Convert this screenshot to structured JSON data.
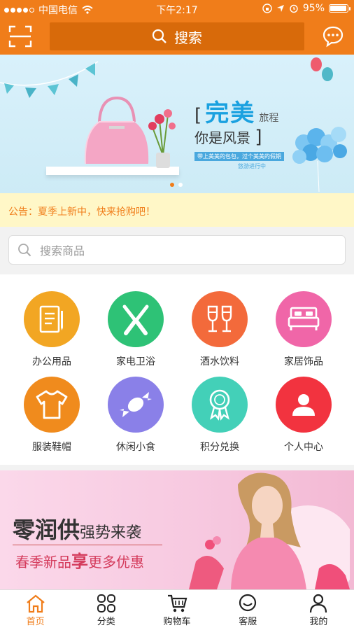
{
  "status_bar": {
    "carrier": "中国电信",
    "time": "下午2:17",
    "battery": "95%",
    "battery_level": 0.95
  },
  "header": {
    "search_label": "搜索"
  },
  "banner": {
    "headline": "完美",
    "suffix": "旅程",
    "line2": "你是风景",
    "tagline": "带上美美的包包，过个美美的假期",
    "tagline2": "悠游进行中",
    "slides": 2,
    "active_slide": 0
  },
  "notice": {
    "text": "公告：夏季上新中，快来抢购吧！"
  },
  "product_search": {
    "placeholder": "搜索商品"
  },
  "categories": [
    {
      "label": "办公用品",
      "color": "#f2a623",
      "icon": "notepad-icon"
    },
    {
      "label": "家电卫浴",
      "color": "#2ec276",
      "icon": "pliers-icon"
    },
    {
      "label": "酒水饮料",
      "color": "#f36a3b",
      "icon": "wine-glasses-icon"
    },
    {
      "label": "家居饰品",
      "color": "#f066a8",
      "icon": "bed-icon"
    },
    {
      "label": "服装鞋帽",
      "color": "#f08b1d",
      "icon": "tshirt-icon"
    },
    {
      "label": "休闲小食",
      "color": "#8a80e8",
      "icon": "candy-icon"
    },
    {
      "label": "积分兑换",
      "color": "#43d0b8",
      "icon": "medal-icon"
    },
    {
      "label": "个人中心",
      "color": "#f2333f",
      "icon": "user-icon"
    }
  ],
  "promo": {
    "title": "零润供",
    "title_suffix": "强势来袭",
    "subtitle_a": "春季新品",
    "subtitle_b": "享",
    "subtitle_c": "更多优惠"
  },
  "tabbar": [
    {
      "label": "首页",
      "icon": "home-icon",
      "active": true
    },
    {
      "label": "分类",
      "icon": "grid-icon",
      "active": false
    },
    {
      "label": "购物车",
      "icon": "cart-icon",
      "active": false
    },
    {
      "label": "客服",
      "icon": "chat-face-icon",
      "active": false
    },
    {
      "label": "我的",
      "icon": "person-icon",
      "active": false
    }
  ],
  "colors": {
    "accent": "#f07d1a",
    "notice_bg": "#fff7c7"
  }
}
